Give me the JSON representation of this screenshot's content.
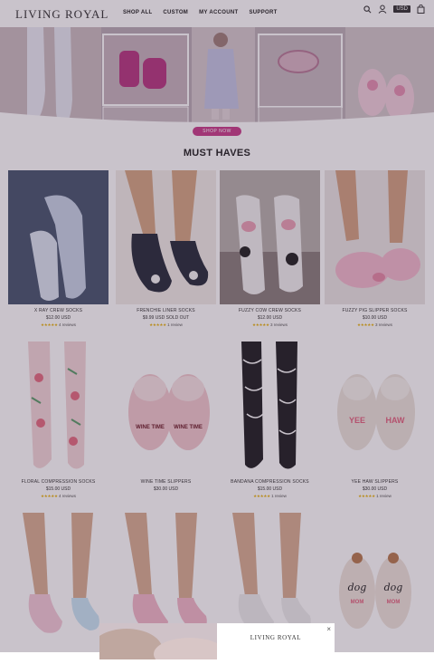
{
  "header": {
    "logo": "LIVING ROYAL",
    "nav": [
      "SHOP ALL",
      "CUSTOM",
      "MY ACCOUNT",
      "SUPPORT"
    ],
    "currency": "USD",
    "icons": [
      "search-icon",
      "account-icon",
      "cart-icon"
    ]
  },
  "hero": {
    "button": "SHOP NOW"
  },
  "section": {
    "title": "MUST HAVES"
  },
  "products": [
    {
      "name": "X RAY CREW SOCKS",
      "price": "$12.00 USD",
      "reviews": "4 reviews",
      "stars": "★★★★★"
    },
    {
      "name": "FRENCHIE LINER SOCKS",
      "price": "$9.99 USD SOLD OUT",
      "reviews": "1 review",
      "stars": "★★★★★"
    },
    {
      "name": "FUZZY COW CREW SOCKS",
      "price": "$12.00 USD",
      "reviews": "3 reviews",
      "stars": "★★★★★"
    },
    {
      "name": "FUZZY PIG SLIPPER SOCKS",
      "price": "$10.00 USD",
      "reviews": "3 reviews",
      "stars": "★★★★★"
    },
    {
      "name": "FLORAL COMPRESSION SOCKS",
      "price": "$15.00 USD",
      "reviews": "4 reviews",
      "stars": "★★★★★"
    },
    {
      "name": "WINE TIME SLIPPERS",
      "price": "$30.00 USD",
      "reviews": "",
      "stars": ""
    },
    {
      "name": "BANDANA COMPRESSION SOCKS",
      "price": "$15.00 USD",
      "reviews": "1 review",
      "stars": "★★★★★"
    },
    {
      "name": "YEE HAW SLIPPERS",
      "price": "$30.00 USD",
      "reviews": "1 review",
      "stars": "★★★★★"
    }
  ],
  "slipper_text": {
    "wine": "WINE TIME",
    "yeehaw_left": "YEE",
    "yeehaw_right": "HAW",
    "dog_left": "dog",
    "dog_right": "dog",
    "mom": "MOM"
  },
  "popup": {
    "brand": "LIVING ROYAL",
    "close": "×"
  }
}
